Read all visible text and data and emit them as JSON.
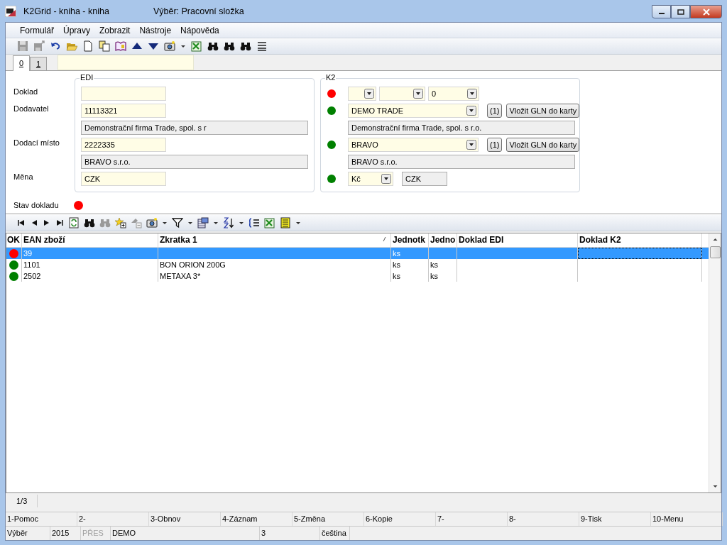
{
  "window": {
    "title": "K2Grid - kniha - kniha",
    "subtitle": "Výběr: Pracovní složka"
  },
  "menu": [
    {
      "label": "Formulář"
    },
    {
      "label": "Úpravy"
    },
    {
      "label": "Zobrazit"
    },
    {
      "label": "Nástroje"
    },
    {
      "label": "Nápověda"
    }
  ],
  "toolbar": [
    {
      "kind": "save",
      "disabled": true
    },
    {
      "kind": "export",
      "disabled": true
    },
    {
      "kind": "undo",
      "disabled": false
    },
    {
      "kind": "folder",
      "disabled": false
    },
    {
      "kind": "page",
      "disabled": false
    },
    {
      "kind": "copy",
      "disabled": false
    },
    {
      "kind": "book",
      "disabled": false
    },
    {
      "kind": "up",
      "disabled": false
    },
    {
      "kind": "down",
      "disabled": false
    },
    {
      "kind": "camera",
      "disabled": false
    },
    {
      "kind": "dropdown",
      "disabled": false
    },
    {
      "kind": "sheet",
      "disabled": false
    },
    {
      "kind": "binoculars",
      "disabled": false
    },
    {
      "kind": "binoculars",
      "disabled": false
    },
    {
      "kind": "binoculars",
      "disabled": false
    },
    {
      "kind": "lines",
      "disabled": false
    }
  ],
  "tabs": [
    {
      "label": "0",
      "selected": true
    },
    {
      "label": "1",
      "selected": false
    }
  ],
  "edi": {
    "title": "EDI",
    "rows": [
      {
        "kind": "input",
        "label": "Doklad"
      },
      {
        "kind": "input",
        "label": "Dodavatel",
        "value": "11113321"
      },
      {
        "kind": "readonly",
        "value": "Demonstrační firma Trade, spol. s r"
      },
      {
        "kind": "input",
        "label": "Dodací místo",
        "value": "2222335"
      },
      {
        "kind": "readonly",
        "value": "BRAVO s.r.o."
      },
      {
        "kind": "input",
        "label": "Měna",
        "value": "CZK"
      }
    ]
  },
  "k2": {
    "title": "K2",
    "rows": [
      {
        "kind": "triple",
        "color": "#ff0000",
        "value": "0"
      },
      {
        "kind": "partner",
        "color": "#008000",
        "value": "DEMO TRADE",
        "count": "(1)",
        "action": "Vložit GLN do karty"
      },
      {
        "kind": "readonly",
        "value": "Demonstrační firma Trade, spol. s r.o."
      },
      {
        "kind": "partner",
        "color": "#008000",
        "value": "BRAVO",
        "count": "(1)",
        "action": "Vložit GLN do karty"
      },
      {
        "kind": "readonly",
        "value": "BRAVO s.r.o."
      },
      {
        "kind": "currency",
        "color": "#008000",
        "value": "Kč",
        "code": "CZK"
      }
    ]
  },
  "status": {
    "label": "Stav dokladu",
    "color": "#ff0000"
  },
  "grid_toolbar": [
    {
      "kind": "first",
      "disabled": false
    },
    {
      "kind": "prev",
      "disabled": false
    },
    {
      "kind": "next",
      "disabled": false
    },
    {
      "kind": "last",
      "disabled": false
    },
    {
      "kind": "refresh",
      "disabled": false
    },
    {
      "kind": "binoculars",
      "disabled": false
    },
    {
      "kind": "binoculars",
      "disabled": true
    },
    {
      "kind": "add",
      "disabled": false
    },
    {
      "kind": "remove",
      "disabled": true
    },
    {
      "kind": "camera",
      "disabled": false
    },
    {
      "kind": "dropdown",
      "disabled": false
    },
    {
      "kind": "filter",
      "disabled": false
    },
    {
      "kind": "dropdown",
      "disabled": false
    },
    {
      "kind": "columns",
      "disabled": false
    },
    {
      "kind": "dropdown",
      "disabled": false
    },
    {
      "kind": "sort",
      "disabled": false
    },
    {
      "kind": "dropdown",
      "disabled": false
    },
    {
      "kind": "list",
      "disabled": false
    },
    {
      "kind": "sheet",
      "disabled": false
    },
    {
      "kind": "table",
      "disabled": false
    },
    {
      "kind": "dropdown",
      "disabled": false
    }
  ],
  "grid": {
    "columns": [
      {
        "label": "OK",
        "sorted": false
      },
      {
        "label": "EAN zboží",
        "sorted": false
      },
      {
        "label": "Zkratka 1",
        "sorted": true
      },
      {
        "label": "Jednotk",
        "sorted": false
      },
      {
        "label": "Jedno",
        "sorted": false
      },
      {
        "label": "Doklad EDI",
        "sorted": false
      },
      {
        "label": "Doklad K2",
        "sorted": false
      }
    ],
    "rows": [
      {
        "color": "#ff0000",
        "selected": true,
        "ean": "39",
        "unit": "ks"
      },
      {
        "color": "#008000",
        "selected": false,
        "ean": "1101",
        "short": "BON ORION 200G",
        "unit": "ks",
        "unit2": "ks"
      },
      {
        "color": "#008000",
        "selected": false,
        "ean": "2502",
        "short": "METAXA 3*",
        "unit": "ks",
        "unit2": "ks"
      }
    ]
  },
  "record_count": "1/3",
  "function_keys": [
    "1-Pomoc",
    "2-",
    "3-Obnov",
    "4-Záznam",
    "5-Změna",
    "6-Kopie",
    "7-",
    "8-",
    "9-Tisk",
    "10-Menu"
  ],
  "status_bar": [
    {
      "text": "Výběr",
      "disabled": false
    },
    {
      "text": "2015",
      "disabled": false
    },
    {
      "text": "PŘES",
      "disabled": true
    },
    {
      "text": "DEMO",
      "disabled": false
    },
    {
      "text": "3",
      "disabled": false
    },
    {
      "text": "čeština",
      "disabled": false
    }
  ]
}
